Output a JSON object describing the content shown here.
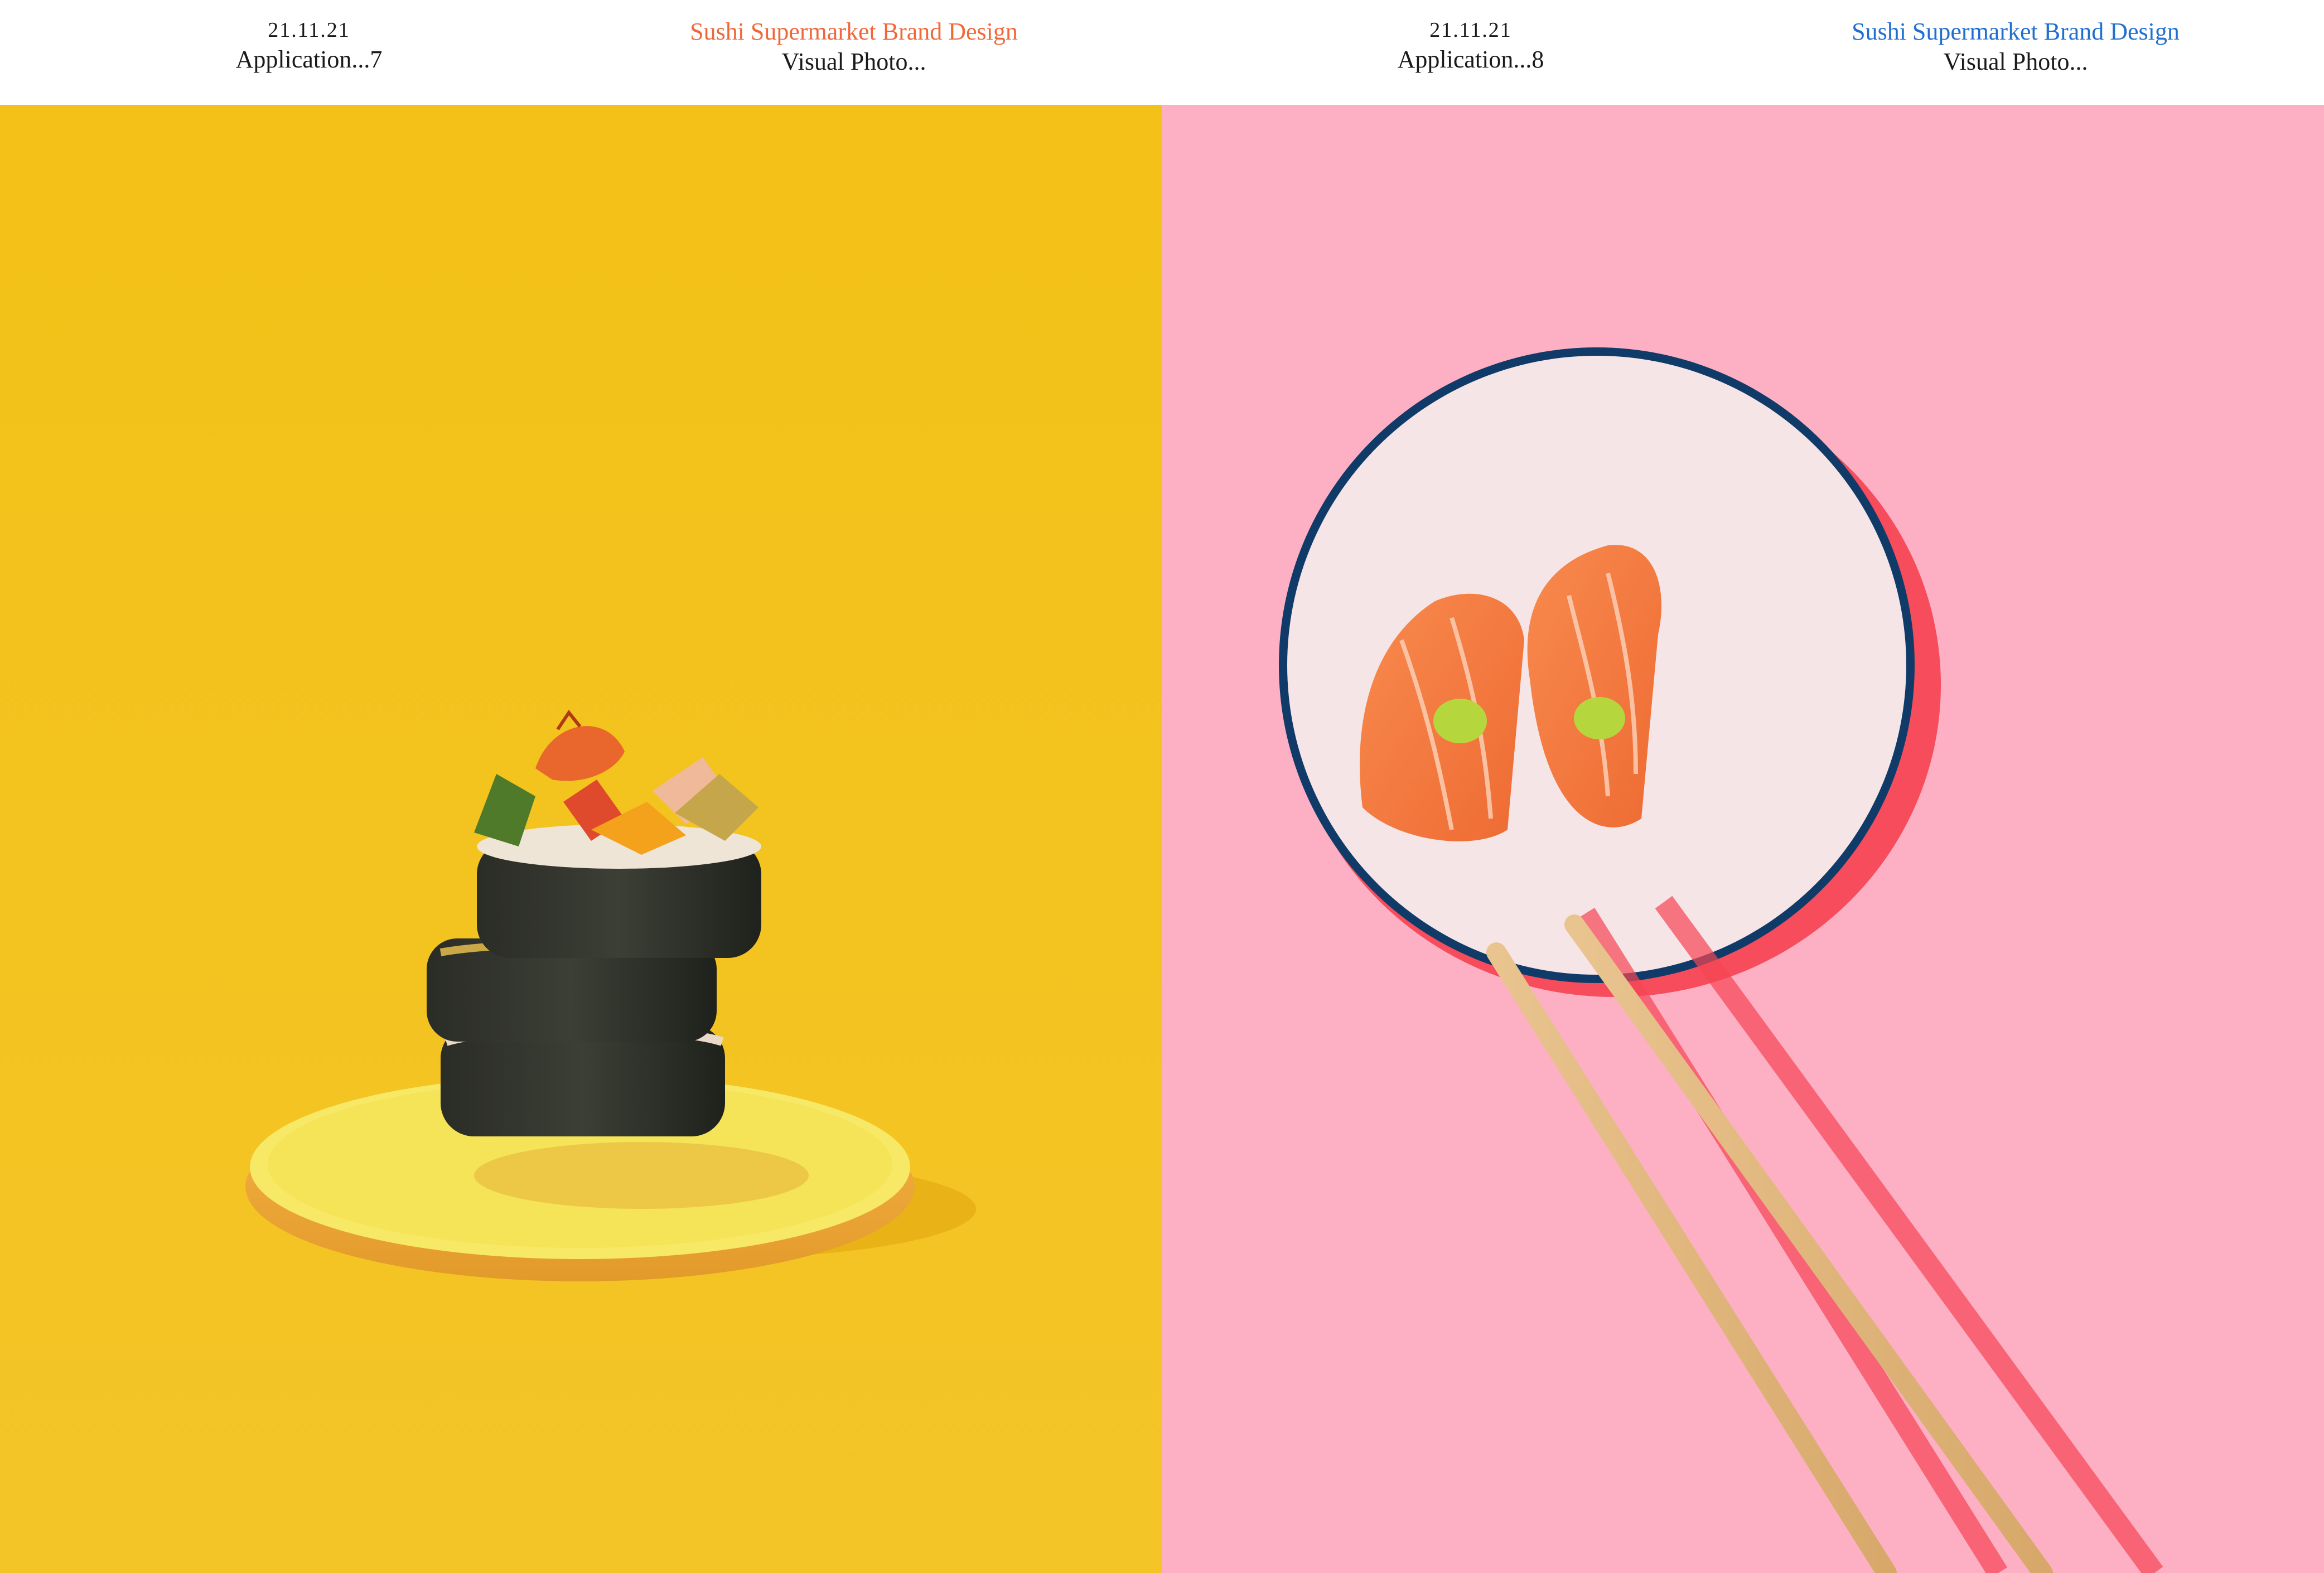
{
  "panels": [
    {
      "date": "21.11.21",
      "application": "Application...7",
      "project": "Sushi Supermarket Brand Design",
      "subtitle": "Visual Photo...",
      "project_color": "#f0683a",
      "background_color": "#f4c21c"
    },
    {
      "date": "21.11.21",
      "application": "Application...8",
      "project": "Sushi Supermarket Brand Design",
      "subtitle": "Visual Photo...",
      "project_color": "#1f6fd0",
      "background_color": "#fdb0c4"
    }
  ]
}
